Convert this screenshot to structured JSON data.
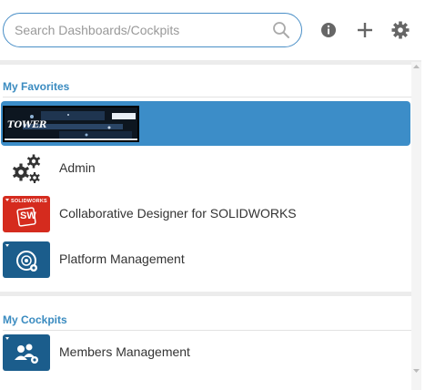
{
  "search": {
    "placeholder": "Search Dashboards/Cockpits",
    "value": ""
  },
  "toolbar": {
    "info_icon": "info-icon",
    "add_icon": "plus-icon",
    "settings_icon": "gear-icon"
  },
  "sections": {
    "favorites": {
      "title": "My Favorites",
      "items": [
        {
          "label": "",
          "icon": "custom-banner-thumbnail",
          "selected": true
        },
        {
          "label": "Admin",
          "icon": "gears-icon"
        },
        {
          "label": "Collaborative Designer for SOLIDWORKS",
          "icon": "solidworks-app-icon"
        },
        {
          "label": "Platform Management",
          "icon": "platform-management-icon"
        }
      ]
    },
    "cockpits": {
      "title": "My Cockpits",
      "items": [
        {
          "label": "Members Management",
          "icon": "members-management-icon"
        }
      ]
    }
  },
  "thumbnail_text": {
    "solidworks_brand": "SOLIDWORKS",
    "sw_mark": "SW",
    "banner_text": "TOWER"
  },
  "colors": {
    "accent": "#3c8dc8",
    "section_title": "#3a8bc0",
    "solidworks_red": "#d52b1e",
    "app_blue": "#1b5d8c"
  }
}
